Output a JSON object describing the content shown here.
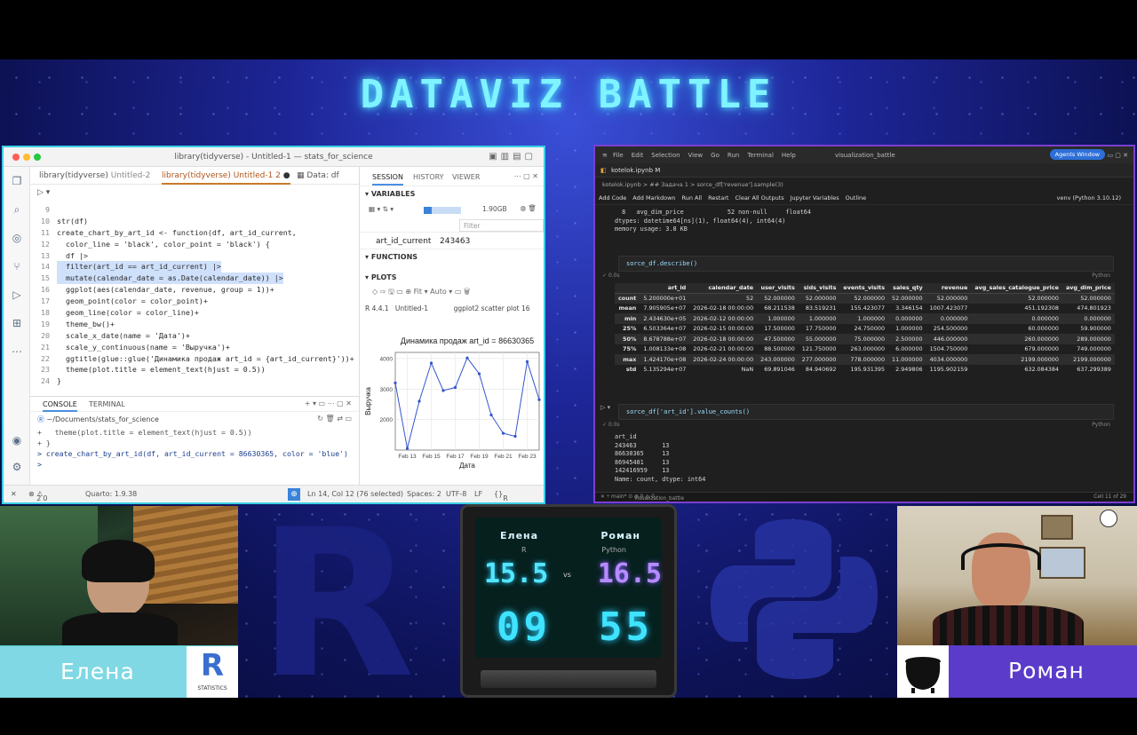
{
  "event_title": "DATAVIZ BATTLE",
  "rstudio": {
    "window_title": "library(tidyverse) - Untitled-1 — stats_for_science",
    "tabs": [
      {
        "label": "library(tidyverse)",
        "file": "Untitled-2"
      },
      {
        "label": "library(tidyverse)",
        "file": "Untitled-1 2"
      },
      {
        "label": "Data: df"
      }
    ],
    "code_lines": [
      {
        "n": "9",
        "t": ""
      },
      {
        "n": "10",
        "t": "str(df)"
      },
      {
        "n": "11",
        "t": "create_chart_by_art_id <- function(df, art_id_current,"
      },
      {
        "n": "12",
        "t": "  color_line = 'black', color_point = 'black') {"
      },
      {
        "n": "13",
        "t": "  df |>"
      },
      {
        "n": "14",
        "t": "  filter(art_id == art_id_current) |>"
      },
      {
        "n": "15",
        "t": "  mutate(calendar_date = as.Date(calendar_date)) |>"
      },
      {
        "n": "16",
        "t": "  ggplot(aes(calendar_date, revenue, group = 1))+"
      },
      {
        "n": "17",
        "t": "  geom_point(color = color_point)+"
      },
      {
        "n": "18",
        "t": "  geom_line(color = color_line)+"
      },
      {
        "n": "19",
        "t": "  theme_bw()+"
      },
      {
        "n": "20",
        "t": "  scale_x_date(name = 'Дата')+"
      },
      {
        "n": "21",
        "t": "  scale_y_continuous(name = 'Выручка')+"
      },
      {
        "n": "22",
        "t": "  ggtitle(glue::glue('Динамика продаж art_id = {art_id_current}'))+"
      },
      {
        "n": "23",
        "t": "  theme(plot.title = element_text(hjust = 0.5))"
      },
      {
        "n": "24",
        "t": "}"
      }
    ],
    "console": {
      "tab_console": "CONSOLE",
      "tab_terminal": "TERMINAL",
      "path": "~/Documents/stats_for_science",
      "lines": [
        "+   theme(plot.title = element_text(hjust = 0.5))",
        "+ }",
        "> create_chart_by_art_id(df, art_id_current = 86630365, color = 'blue')",
        ">"
      ]
    },
    "status": {
      "errors": "2",
      "warnings": "0",
      "quarto": "Quarto: 1.9.38",
      "position": "Ln 14, Col 12 (76 selected)",
      "spaces": "Spaces: 2",
      "encoding": "UTF-8",
      "eol": "LF",
      "lang": "R"
    },
    "session": {
      "tab_session": "SESSION",
      "tab_history": "HISTORY",
      "tab_viewer": "VIEWER",
      "variables_label": "VARIABLES",
      "memory": "1.90GB",
      "filter_placeholder": "Filter",
      "var_name": "art_id_current",
      "var_value": "243463",
      "functions_label": "FUNCTIONS",
      "plots_label": "PLOTS",
      "fit": "Fit",
      "auto": "Auto",
      "r_version": "R 4.4.1",
      "plot_source": "Untitled-1",
      "plot_desc": "ggplot2 scatter plot 16"
    }
  },
  "chart_data": {
    "type": "line",
    "title": "Динамика продаж art_id = 86630365",
    "xlabel": "Дата",
    "ylabel": "Выручка",
    "x": [
      "2026-02-12",
      "2026-02-13",
      "2026-02-14",
      "2026-02-15",
      "2026-02-16",
      "2026-02-17",
      "2026-02-18",
      "2026-02-19",
      "2026-02-20",
      "2026-02-21",
      "2026-02-22",
      "2026-02-23",
      "2026-02-24"
    ],
    "values": [
      3200,
      1050,
      2600,
      3850,
      2950,
      3050,
      4020,
      3500,
      2150,
      1550,
      1450,
      3900,
      2650
    ],
    "xticks": [
      "Feb 13",
      "Feb 15",
      "Feb 17",
      "Feb 19",
      "Feb 21",
      "Feb 23"
    ],
    "yticks": [
      2000,
      3000,
      4000
    ],
    "ylim": [
      1000,
      4200
    ],
    "color": "#3355cc",
    "grid": true
  },
  "jupyter": {
    "menu": [
      "File",
      "Edit",
      "Selection",
      "View",
      "Go",
      "Run",
      "Terminal",
      "Help"
    ],
    "window_title": "visualization_battle",
    "agents_label": "Agents Window",
    "file_tab": "kotelok.ipynb M",
    "breadcrumb": "kotelok.ipynb > ## Задача 1 > sorce_df['revenue'].sample(3)",
    "toolbar": [
      "Add Code",
      "Add Markdown",
      "Run All",
      "Restart",
      "Clear All Outputs",
      "Jupyter Variables",
      "Outline"
    ],
    "kernel": "venv (Python 3.10.12)",
    "info_lines": [
      "  8   avg_dim_price            52 non-null     float64",
      "dtypes: datetime64[ns](1), float64(4), int64(4)",
      "memory usage: 3.8 KB"
    ],
    "cell1": "sorce_df.describe()",
    "cell2": "sorce_df['art_id'].value_counts()",
    "exec_time": "0.0s",
    "lang": "Python",
    "describe_headers": [
      "",
      "art_id",
      "calendar_date",
      "user_visits",
      "sids_visits",
      "events_visits",
      "sales_qty",
      "revenue",
      "avg_sales_catalogue_price",
      "avg_dim_price"
    ],
    "describe_rows": [
      [
        "count",
        "5.200000e+01",
        "52",
        "52.000000",
        "52.000000",
        "52.000000",
        "52.000000",
        "52.000000",
        "52.000000",
        "52.000000"
      ],
      [
        "mean",
        "7.905905e+07",
        "2026-02-18 00:00:00",
        "68.211538",
        "83.519231",
        "155.423077",
        "3.346154",
        "1007.423077",
        "451.192308",
        "474.801923"
      ],
      [
        "min",
        "2.434630e+05",
        "2026-02-12 00:00:00",
        "1.000000",
        "1.000000",
        "1.000000",
        "0.000000",
        "0.000000",
        "0.000000",
        "0.000000"
      ],
      [
        "25%",
        "6.503364e+07",
        "2026-02-15 00:00:00",
        "17.500000",
        "17.750000",
        "24.750000",
        "1.000000",
        "254.500000",
        "60.000000",
        "59.900000"
      ],
      [
        "50%",
        "8.678788e+07",
        "2026-02-18 00:00:00",
        "47.500000",
        "55.000000",
        "75.000000",
        "2.500000",
        "446.000000",
        "260.000000",
        "289.000000"
      ],
      [
        "75%",
        "1.008133e+08",
        "2026-02-21 00:00:00",
        "88.500000",
        "121.750000",
        "263.000000",
        "6.000000",
        "1504.750000",
        "679.000000",
        "749.000000"
      ],
      [
        "max",
        "1.424170e+08",
        "2026-02-24 00:00:00",
        "243.000000",
        "277.000000",
        "778.000000",
        "11.000000",
        "4034.000000",
        "2199.000000",
        "2199.000000"
      ],
      [
        "std",
        "5.135294e+07",
        "NaN",
        "69.891046",
        "84.940692",
        "195.931395",
        "2.949806",
        "1195.902159",
        "632.084384",
        "637.299389"
      ]
    ],
    "value_counts": [
      "art_id",
      "243463       13",
      "86630365     13",
      "86945481     13",
      "142416959    13",
      "Name: count, dtype: int64"
    ],
    "status_left": "visualization_battle",
    "status_right": "Cell 11 of 29"
  },
  "players": {
    "left": {
      "name": "Елена",
      "lang": "R",
      "score": "15.5",
      "timer": "09"
    },
    "right": {
      "name": "Роман",
      "lang": "Python",
      "score": "16.5",
      "timer": "55"
    },
    "vs": "vs",
    "r_logo_caption": "STATISTICS"
  }
}
